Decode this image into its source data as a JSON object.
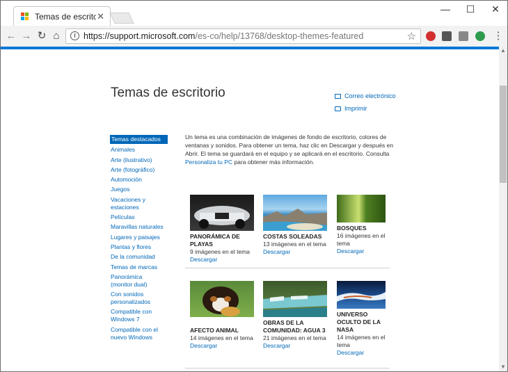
{
  "browser": {
    "tab_title": "Temas de escritorio destacados",
    "tab_close": "✕",
    "window_controls": {
      "minimize": "—",
      "maximize": "☐",
      "close": "✕"
    },
    "nav_icons": {
      "back": "back-arrow-icon",
      "forward": "forward-arrow-icon",
      "reload": "reload-icon",
      "home": "home-icon"
    },
    "url_host": "https://support.microsoft.com",
    "url_path": "/es-co/help/13768/desktop-themes-featured",
    "extensions": [
      "adblock-icon",
      "cast-icon",
      "tabs-icon",
      "account-icon",
      "menu-icon"
    ],
    "colors": {
      "accent": "#0078d7",
      "link": "#0067b8"
    }
  },
  "page": {
    "title": "Temas de escritorio",
    "share": {
      "email": "Correo electrónico",
      "print": "Imprimir"
    },
    "intro": {
      "text_before": "Un tema es una combinación de imágenes de fondo de escritorio, colores de ventanas y sonidos. Para obtener un tema, haz clic en Descargar y después en Abrir. El tema se guardará en el equipo y se aplicará en el escritorio. Consulta ",
      "link": "Personaliza tu PC",
      "text_after": " para obtener más información."
    },
    "sidenav": [
      {
        "label": "Temas destacados"
      },
      {
        "label": "Animales"
      },
      {
        "label": "Arte (ilustrativo)"
      },
      {
        "label": "Arte (fotográfico)"
      },
      {
        "label": "Automoción"
      },
      {
        "label": "Juegos"
      },
      {
        "label": "Vacaciones y estaciones"
      },
      {
        "label": "Películas"
      },
      {
        "label": "Maravillas naturales"
      },
      {
        "label": "Lugares y paisajes"
      },
      {
        "label": "Plantas y flores"
      },
      {
        "label": "De la comunidad"
      },
      {
        "label": "Temas de marcas"
      },
      {
        "label": "Panorámica (monitor dual)"
      },
      {
        "label": "Con sonidos personalizados"
      },
      {
        "label": "Compatible con Windows 7"
      },
      {
        "label": "Compatible con el nuevo Windows"
      }
    ],
    "themes": [
      {
        "name": "Panorámica de playas",
        "count": "9 imágenes en el tema",
        "download": "Descargar"
      },
      {
        "name": "Costas soleadas",
        "count": "13 imágenes en el tema",
        "download": "Descargar"
      },
      {
        "name": "Bosques",
        "count": "16 imágenes en el tema",
        "download": "Descargar"
      },
      {
        "name": "Afecto animal",
        "count": "14 imágenes en el tema",
        "download": "Descargar"
      },
      {
        "name": "Obras de la comunidad: Agua 3",
        "count": "21 imágenes en el tema",
        "download": "Descargar"
      },
      {
        "name": "Universo oculto de la NASA",
        "count": "14 imágenes en el tema",
        "download": "Descargar"
      }
    ]
  }
}
